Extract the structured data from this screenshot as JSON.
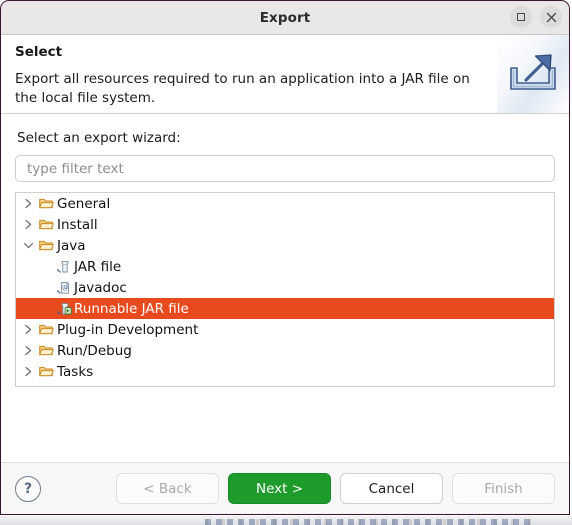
{
  "window": {
    "title": "Export",
    "maximize_icon": "maximize-icon",
    "close_icon": "close-icon"
  },
  "header": {
    "title": "Select",
    "description": "Export all resources required to run an application into a JAR file on the local file system.",
    "icon": "export-arrow-icon"
  },
  "form": {
    "wizard_label": "Select an export wizard:",
    "filter_placeholder": "type filter text",
    "filter_value": ""
  },
  "tree": {
    "items": [
      {
        "label": "General",
        "icon": "folder-icon",
        "level": 0,
        "expanded": false,
        "has_children": true,
        "selected": false
      },
      {
        "label": "Install",
        "icon": "folder-icon",
        "level": 0,
        "expanded": false,
        "has_children": true,
        "selected": false
      },
      {
        "label": "Java",
        "icon": "folder-icon",
        "level": 0,
        "expanded": true,
        "has_children": true,
        "selected": false
      },
      {
        "label": "JAR file",
        "icon": "jar-file-icon",
        "level": 1,
        "expanded": false,
        "has_children": false,
        "selected": false
      },
      {
        "label": "Javadoc",
        "icon": "javadoc-icon",
        "level": 1,
        "expanded": false,
        "has_children": false,
        "selected": false
      },
      {
        "label": "Runnable JAR file",
        "icon": "runnable-jar-icon",
        "level": 1,
        "expanded": false,
        "has_children": false,
        "selected": true
      },
      {
        "label": "Plug-in Development",
        "icon": "folder-icon",
        "level": 0,
        "expanded": false,
        "has_children": true,
        "selected": false
      },
      {
        "label": "Run/Debug",
        "icon": "folder-icon",
        "level": 0,
        "expanded": false,
        "has_children": true,
        "selected": false
      },
      {
        "label": "Tasks",
        "icon": "folder-icon",
        "level": 0,
        "expanded": false,
        "has_children": true,
        "selected": false
      }
    ],
    "selection_color": "#e8491d",
    "selection_text_color": "#ffffff"
  },
  "footer": {
    "help_label": "?",
    "back_label": "< Back",
    "next_label": "Next >",
    "cancel_label": "Cancel",
    "finish_label": "Finish",
    "back_enabled": false,
    "next_enabled": true,
    "cancel_enabled": true,
    "finish_enabled": false,
    "primary_color": "#1d9b2b"
  }
}
